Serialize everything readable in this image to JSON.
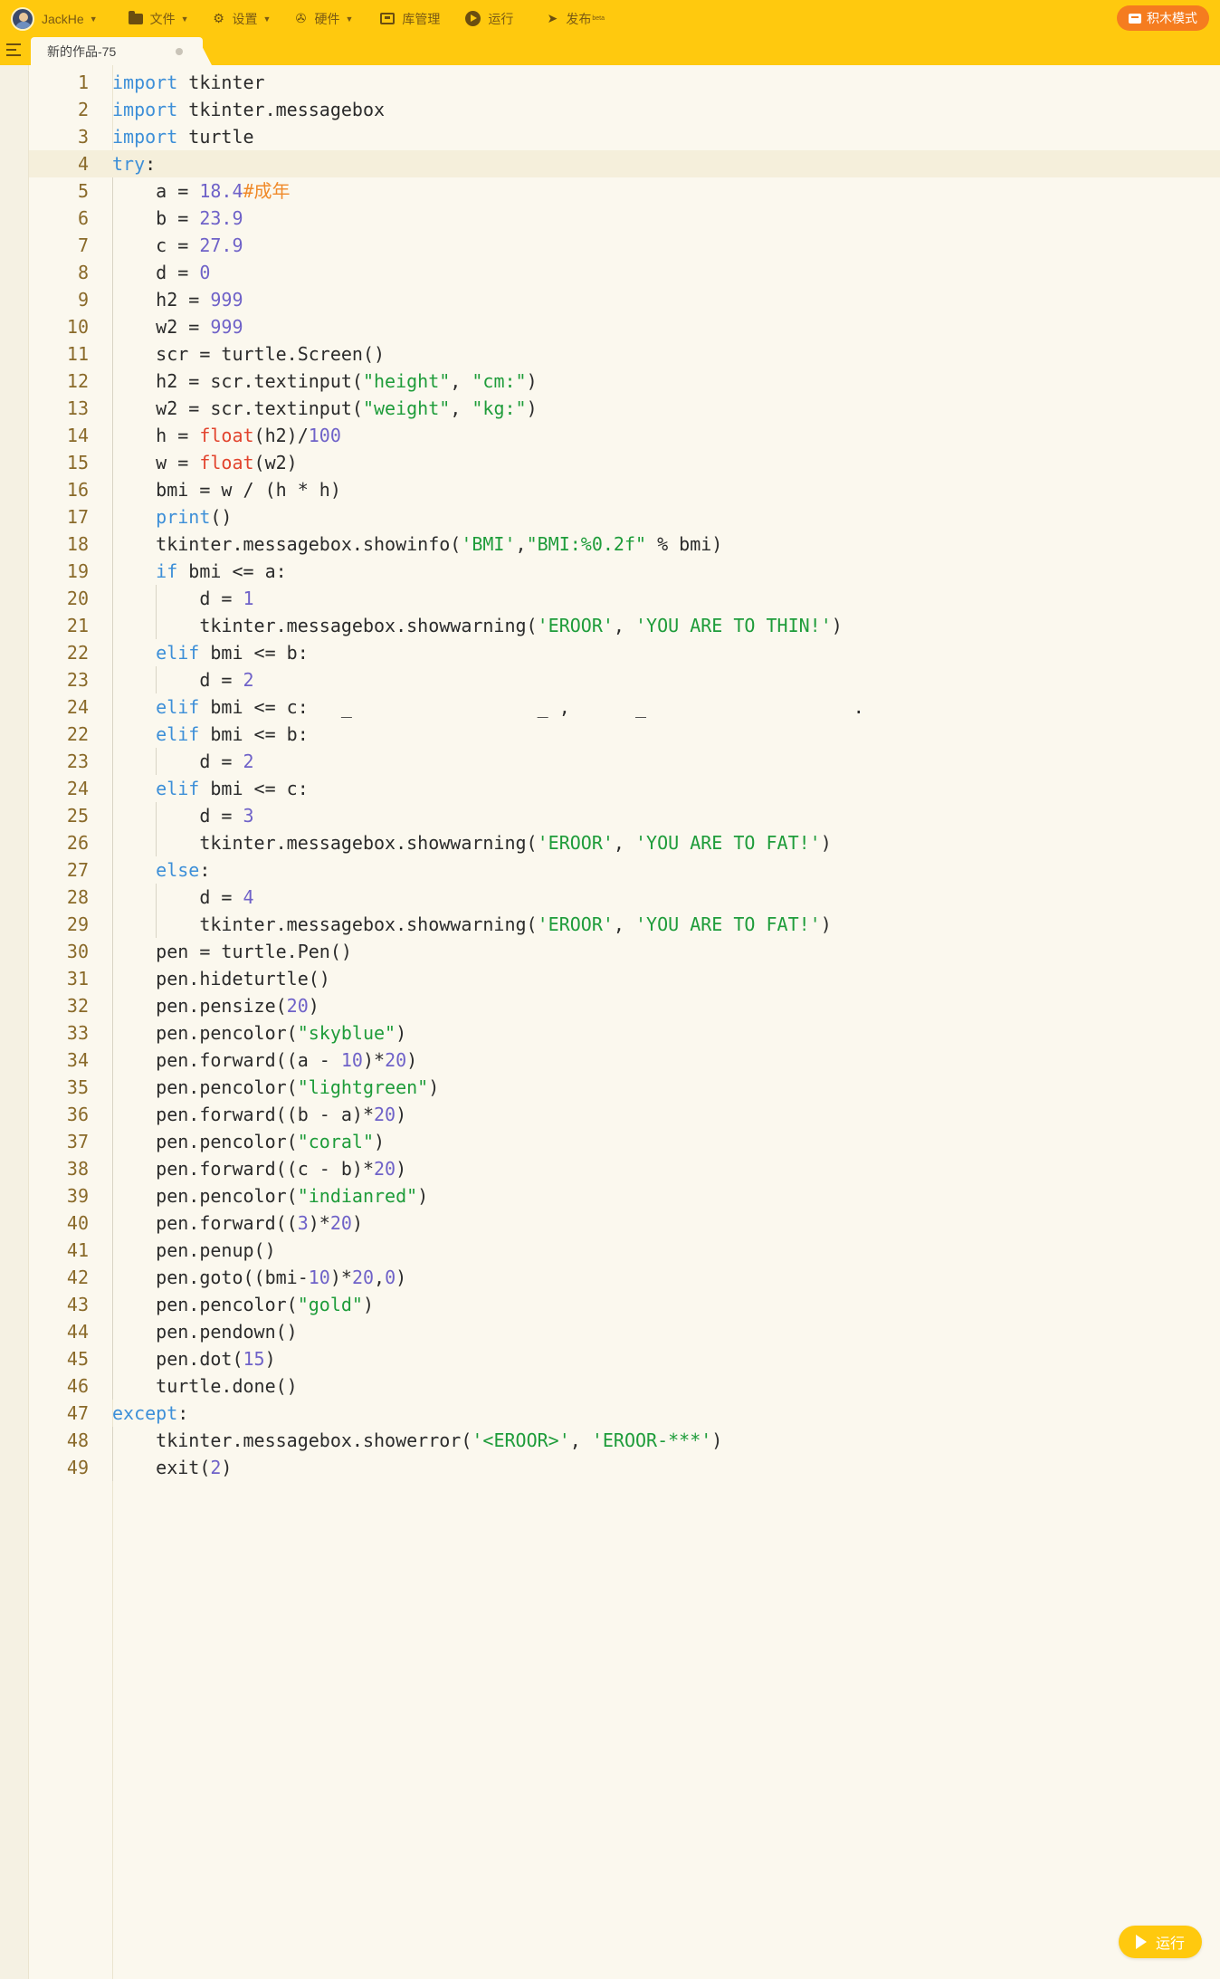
{
  "toolbar": {
    "username": "JackHe",
    "menu": [
      {
        "label": "文件",
        "icon": "folder-icon"
      },
      {
        "label": "设置",
        "icon": "gear-icon"
      },
      {
        "label": "硬件",
        "icon": "hardware-icon"
      },
      {
        "label": "库管理",
        "icon": "library-icon"
      },
      {
        "label": "运行",
        "icon": "run-icon"
      },
      {
        "label": "发布",
        "icon": "send-icon",
        "badge": "beta"
      }
    ],
    "block_mode_label": "积木模式"
  },
  "tab": {
    "title": "新的作品-75"
  },
  "run_button_label": "运行",
  "colors": {
    "toolbar": "#ffc90e",
    "keyword": "#3d8fd8",
    "number": "#6f62c8",
    "string": "#1e9c3a",
    "builtin": "#e2442e",
    "comment": "#f08a2a"
  },
  "code": [
    {
      "n": "1",
      "indent": 0,
      "t": [
        [
          "kw",
          "import"
        ],
        [
          "p",
          " tkinter"
        ]
      ]
    },
    {
      "n": "2",
      "indent": 0,
      "t": [
        [
          "kw",
          "import"
        ],
        [
          "p",
          " tkinter.messagebox"
        ]
      ]
    },
    {
      "n": "3",
      "indent": 0,
      "t": [
        [
          "kw",
          "import"
        ],
        [
          "p",
          " turtle"
        ]
      ]
    },
    {
      "n": "4",
      "indent": 0,
      "active": true,
      "t": [
        [
          "kw",
          "try"
        ],
        [
          "p",
          ":"
        ]
      ]
    },
    {
      "n": "5",
      "indent": 1,
      "t": [
        [
          "p",
          "    a = "
        ],
        [
          "num",
          "18.4"
        ],
        [
          "cmt",
          "#成年"
        ]
      ]
    },
    {
      "n": "6",
      "indent": 1,
      "t": [
        [
          "p",
          "    b = "
        ],
        [
          "num",
          "23.9"
        ]
      ]
    },
    {
      "n": "7",
      "indent": 1,
      "t": [
        [
          "p",
          "    c = "
        ],
        [
          "num",
          "27.9"
        ]
      ]
    },
    {
      "n": "8",
      "indent": 1,
      "t": [
        [
          "p",
          "    d = "
        ],
        [
          "num",
          "0"
        ]
      ]
    },
    {
      "n": "9",
      "indent": 1,
      "t": [
        [
          "p",
          "    h2 = "
        ],
        [
          "num",
          "999"
        ]
      ]
    },
    {
      "n": "10",
      "indent": 1,
      "t": [
        [
          "p",
          "    w2 = "
        ],
        [
          "num",
          "999"
        ]
      ]
    },
    {
      "n": "11",
      "indent": 1,
      "t": [
        [
          "p",
          "    scr = turtle.Screen()"
        ]
      ]
    },
    {
      "n": "12",
      "indent": 1,
      "t": [
        [
          "p",
          "    h2 = scr.textinput("
        ],
        [
          "str",
          "\"height\""
        ],
        [
          "p",
          ", "
        ],
        [
          "str",
          "\"cm:\""
        ],
        [
          "p",
          ")"
        ]
      ]
    },
    {
      "n": "13",
      "indent": 1,
      "t": [
        [
          "p",
          "    w2 = scr.textinput("
        ],
        [
          "str",
          "\"weight\""
        ],
        [
          "p",
          ", "
        ],
        [
          "str",
          "\"kg:\""
        ],
        [
          "p",
          ")"
        ]
      ]
    },
    {
      "n": "14",
      "indent": 1,
      "t": [
        [
          "p",
          "    h = "
        ],
        [
          "fn",
          "float"
        ],
        [
          "p",
          "(h2)/"
        ],
        [
          "num",
          "100"
        ]
      ]
    },
    {
      "n": "15",
      "indent": 1,
      "t": [
        [
          "p",
          "    w = "
        ],
        [
          "fn",
          "float"
        ],
        [
          "p",
          "(w2)"
        ]
      ]
    },
    {
      "n": "16",
      "indent": 1,
      "t": [
        [
          "p",
          "    bmi = w / (h * h)"
        ]
      ]
    },
    {
      "n": "17",
      "indent": 1,
      "t": [
        [
          "p",
          "    "
        ],
        [
          "kw",
          "print"
        ],
        [
          "p",
          "()"
        ]
      ]
    },
    {
      "n": "18",
      "indent": 1,
      "t": [
        [
          "p",
          "    tkinter.messagebox.showinfo("
        ],
        [
          "str",
          "'BMI'"
        ],
        [
          "p",
          ","
        ],
        [
          "str",
          "\"BMI:%0.2f\""
        ],
        [
          "p",
          " % bmi)"
        ]
      ]
    },
    {
      "n": "19",
      "indent": 1,
      "t": [
        [
          "p",
          "    "
        ],
        [
          "kw",
          "if"
        ],
        [
          "p",
          " bmi <= a:"
        ]
      ]
    },
    {
      "n": "20",
      "indent": 2,
      "t": [
        [
          "p",
          "        d = "
        ],
        [
          "num",
          "1"
        ]
      ]
    },
    {
      "n": "21",
      "indent": 2,
      "t": [
        [
          "p",
          "        tkinter.messagebox.showwarning("
        ],
        [
          "str",
          "'EROOR'"
        ],
        [
          "p",
          ", "
        ],
        [
          "str",
          "'YOU ARE TO THIN!'"
        ],
        [
          "p",
          ")"
        ]
      ]
    },
    {
      "n": "22",
      "indent": 1,
      "t": [
        [
          "p",
          "    "
        ],
        [
          "kw",
          "elif"
        ],
        [
          "p",
          " bmi <= b:"
        ]
      ]
    },
    {
      "n": "23",
      "indent": 2,
      "t": [
        [
          "p",
          "        d = "
        ],
        [
          "num",
          "2"
        ]
      ]
    },
    {
      "n": "24",
      "indent": 1,
      "t": [
        [
          "p",
          "    "
        ],
        [
          "kw",
          "elif"
        ],
        [
          "p",
          " bmi <= c:   _                 _ ,      _                   ."
        ]
      ]
    },
    {
      "n": "22",
      "indent": 1,
      "t": [
        [
          "p",
          "    "
        ],
        [
          "kw",
          "elif"
        ],
        [
          "p",
          " bmi <= b:"
        ]
      ]
    },
    {
      "n": "23",
      "indent": 2,
      "t": [
        [
          "p",
          "        d = "
        ],
        [
          "num",
          "2"
        ]
      ]
    },
    {
      "n": "24",
      "indent": 1,
      "t": [
        [
          "p",
          "    "
        ],
        [
          "kw",
          "elif"
        ],
        [
          "p",
          " bmi <= c:"
        ]
      ]
    },
    {
      "n": "25",
      "indent": 2,
      "t": [
        [
          "p",
          "        d = "
        ],
        [
          "num",
          "3"
        ]
      ]
    },
    {
      "n": "26",
      "indent": 2,
      "t": [
        [
          "p",
          "        tkinter.messagebox.showwarning("
        ],
        [
          "str",
          "'EROOR'"
        ],
        [
          "p",
          ", "
        ],
        [
          "str",
          "'YOU ARE TO FAT!'"
        ],
        [
          "p",
          ")"
        ]
      ]
    },
    {
      "n": "27",
      "indent": 1,
      "t": [
        [
          "p",
          "    "
        ],
        [
          "kw",
          "else"
        ],
        [
          "p",
          ":"
        ]
      ]
    },
    {
      "n": "28",
      "indent": 2,
      "t": [
        [
          "p",
          "        d = "
        ],
        [
          "num",
          "4"
        ]
      ]
    },
    {
      "n": "29",
      "indent": 2,
      "t": [
        [
          "p",
          "        tkinter.messagebox.showwarning("
        ],
        [
          "str",
          "'EROOR'"
        ],
        [
          "p",
          ", "
        ],
        [
          "str",
          "'YOU ARE TO FAT!'"
        ],
        [
          "p",
          ")"
        ]
      ]
    },
    {
      "n": "30",
      "indent": 1,
      "t": [
        [
          "p",
          "    pen = turtle.Pen()"
        ]
      ]
    },
    {
      "n": "31",
      "indent": 1,
      "t": [
        [
          "p",
          "    pen.hideturtle()"
        ]
      ]
    },
    {
      "n": "32",
      "indent": 1,
      "t": [
        [
          "p",
          "    pen.pensize("
        ],
        [
          "num",
          "20"
        ],
        [
          "p",
          ")"
        ]
      ]
    },
    {
      "n": "33",
      "indent": 1,
      "t": [
        [
          "p",
          "    pen.pencolor("
        ],
        [
          "str",
          "\"skyblue\""
        ],
        [
          "p",
          ")"
        ]
      ]
    },
    {
      "n": "34",
      "indent": 1,
      "t": [
        [
          "p",
          "    pen.forward((a - "
        ],
        [
          "num",
          "10"
        ],
        [
          "p",
          ")*"
        ],
        [
          "num",
          "20"
        ],
        [
          "p",
          ")"
        ]
      ]
    },
    {
      "n": "35",
      "indent": 1,
      "t": [
        [
          "p",
          "    pen.pencolor("
        ],
        [
          "str",
          "\"lightgreen\""
        ],
        [
          "p",
          ")"
        ]
      ]
    },
    {
      "n": "36",
      "indent": 1,
      "t": [
        [
          "p",
          "    pen.forward((b - a)*"
        ],
        [
          "num",
          "20"
        ],
        [
          "p",
          ")"
        ]
      ]
    },
    {
      "n": "37",
      "indent": 1,
      "t": [
        [
          "p",
          "    pen.pencolor("
        ],
        [
          "str",
          "\"coral\""
        ],
        [
          "p",
          ")"
        ]
      ]
    },
    {
      "n": "38",
      "indent": 1,
      "t": [
        [
          "p",
          "    pen.forward((c - b)*"
        ],
        [
          "num",
          "20"
        ],
        [
          "p",
          ")"
        ]
      ]
    },
    {
      "n": "39",
      "indent": 1,
      "t": [
        [
          "p",
          "    pen.pencolor("
        ],
        [
          "str",
          "\"indianred\""
        ],
        [
          "p",
          ")"
        ]
      ]
    },
    {
      "n": "40",
      "indent": 1,
      "t": [
        [
          "p",
          "    pen.forward(("
        ],
        [
          "num",
          "3"
        ],
        [
          "p",
          ")*"
        ],
        [
          "num",
          "20"
        ],
        [
          "p",
          ")"
        ]
      ]
    },
    {
      "n": "41",
      "indent": 1,
      "t": [
        [
          "p",
          "    pen.penup()"
        ]
      ]
    },
    {
      "n": "42",
      "indent": 1,
      "t": [
        [
          "p",
          "    pen.goto((bmi-"
        ],
        [
          "num",
          "10"
        ],
        [
          "p",
          ")*"
        ],
        [
          "num",
          "20"
        ],
        [
          "p",
          ","
        ],
        [
          "num",
          "0"
        ],
        [
          "p",
          ")"
        ]
      ]
    },
    {
      "n": "43",
      "indent": 1,
      "t": [
        [
          "p",
          "    pen.pencolor("
        ],
        [
          "str",
          "\"gold\""
        ],
        [
          "p",
          ")"
        ]
      ]
    },
    {
      "n": "44",
      "indent": 1,
      "t": [
        [
          "p",
          "    pen.pendown()"
        ]
      ]
    },
    {
      "n": "45",
      "indent": 1,
      "t": [
        [
          "p",
          "    pen.dot("
        ],
        [
          "num",
          "15"
        ],
        [
          "p",
          ")"
        ]
      ]
    },
    {
      "n": "46",
      "indent": 1,
      "t": [
        [
          "p",
          "    turtle.done()"
        ]
      ]
    },
    {
      "n": "47",
      "indent": 0,
      "t": [
        [
          "kw",
          "except"
        ],
        [
          "p",
          ":"
        ]
      ]
    },
    {
      "n": "48",
      "indent": 1,
      "t": [
        [
          "p",
          "    tkinter.messagebox.showerror("
        ],
        [
          "str",
          "'<EROOR>'"
        ],
        [
          "p",
          ", "
        ],
        [
          "str",
          "'EROOR-***'"
        ],
        [
          "p",
          ")"
        ]
      ]
    },
    {
      "n": "49",
      "indent": 1,
      "t": [
        [
          "p",
          "    exit("
        ],
        [
          "num",
          "2"
        ],
        [
          "p",
          ")"
        ]
      ]
    }
  ]
}
